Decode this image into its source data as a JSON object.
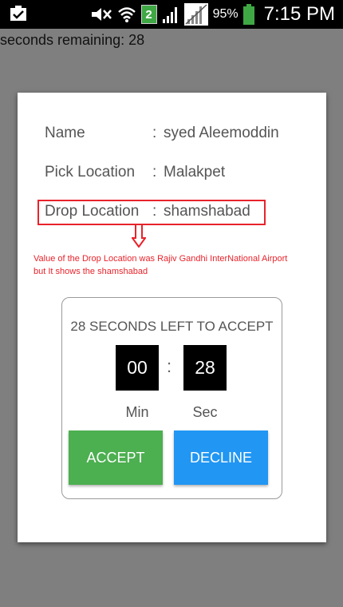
{
  "status_bar": {
    "icons": [
      "clipboard-check-icon",
      "mute-icon",
      "wifi-icon",
      "network-badge-icon",
      "signal-icon",
      "signal-icon-2",
      "battery-icon"
    ],
    "network_badge": "2",
    "battery_percent": "95%",
    "time": "7:15 PM"
  },
  "seconds_remaining": "seconds remaining: 28",
  "dialog": {
    "rows": [
      {
        "label": "Name",
        "sep": ":",
        "value": "syed Aleemoddin"
      },
      {
        "label": "Pick Location",
        "sep": ":",
        "value": "Malakpet"
      },
      {
        "label": "Drop Location",
        "sep": ":",
        "value": "shamshabad"
      }
    ],
    "annotation": "Value of the Drop Location was Rajiv Gandhi InterNational Airport but It shows the shamshabad",
    "highlight_color": "#e8232b",
    "timer": {
      "heading": "28  SECONDS LEFT TO ACCEPT",
      "minutes": "00",
      "seconds": "28",
      "colon": ":",
      "min_label": "Min",
      "sec_label": "Sec"
    },
    "buttons": {
      "accept": "ACCEPT",
      "decline": "DECLINE",
      "accept_color": "#4caf50",
      "decline_color": "#2196f3"
    }
  }
}
